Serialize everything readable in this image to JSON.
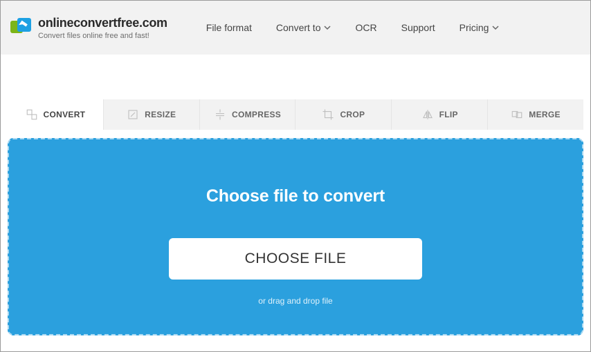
{
  "header": {
    "brand_title": "onlineconvertfree.com",
    "brand_sub": "Convert files online free and fast!",
    "nav": {
      "file_format": "File format",
      "convert_to": "Convert to",
      "ocr": "OCR",
      "support": "Support",
      "pricing": "Pricing"
    }
  },
  "tabs": {
    "convert": "CONVERT",
    "resize": "RESIZE",
    "compress": "COMPRESS",
    "crop": "CROP",
    "flip": "FLIP",
    "merge": "MERGE"
  },
  "drop": {
    "heading": "Choose file to convert",
    "button": "CHOOSE FILE",
    "drag_text": "or drag and drop file"
  }
}
